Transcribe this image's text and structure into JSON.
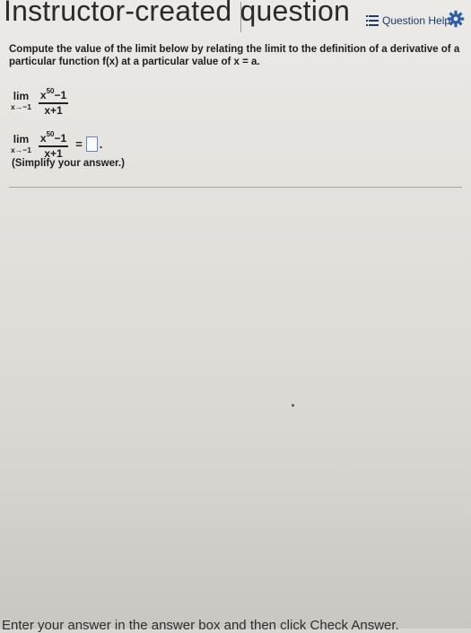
{
  "header": {
    "title": "Instructor-created question",
    "question_help_label": "Question Help",
    "list_icon": "list-icon",
    "settings_icon": "gear-icon"
  },
  "question": {
    "prompt": "Compute the value of the limit below by relating the limit to the definition of a derivative of a particular function f(x) at a particular value of x = a.",
    "lim_word": "lim",
    "lim_sub": "x→−1",
    "numerator_base": "x",
    "numerator_exp": "50",
    "numerator_rest": "−1",
    "denominator": "x+1",
    "answer_value": "",
    "equals_sign": "=",
    "period": ".",
    "simplify_note": "(Simplify your answer.)"
  },
  "footer": {
    "instruction": "Enter your answer in the answer box and then click Check Answer."
  },
  "colors": {
    "accent": "#1b3a6b",
    "answer_box_border": "#5a88c4"
  }
}
